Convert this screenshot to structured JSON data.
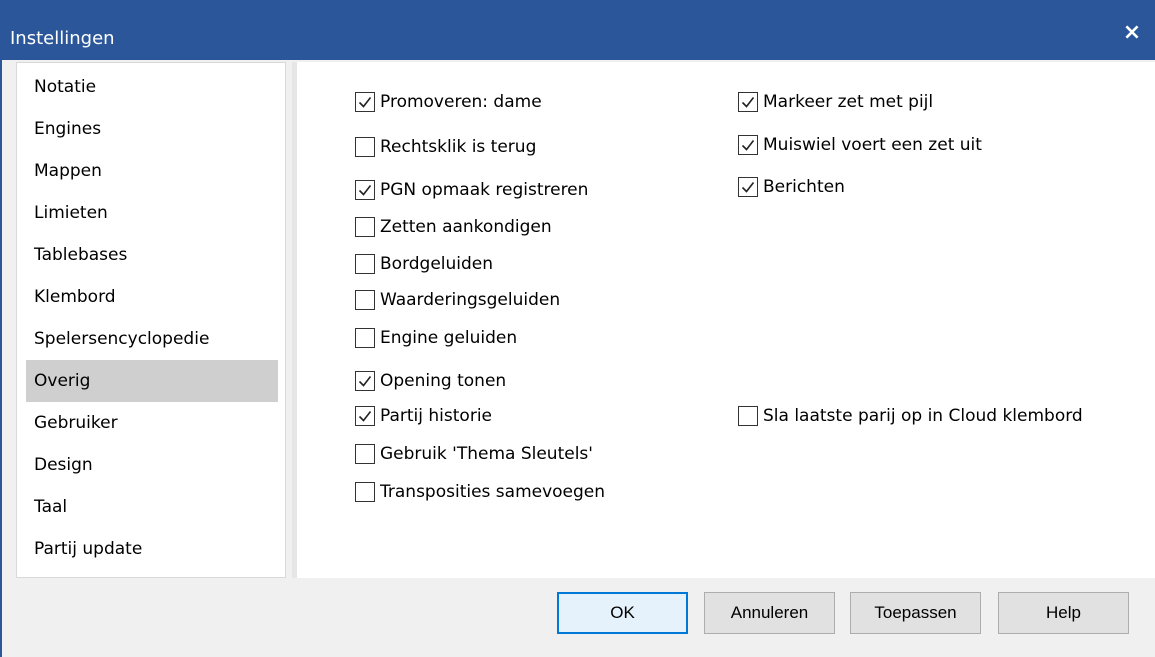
{
  "window": {
    "title": "Instellingen",
    "close_glyph": "×"
  },
  "sidebar": {
    "selected_index": 7,
    "items": [
      {
        "label": "Notatie"
      },
      {
        "label": "Engines"
      },
      {
        "label": "Mappen"
      },
      {
        "label": "Limieten"
      },
      {
        "label": "Tablebases"
      },
      {
        "label": "Klembord"
      },
      {
        "label": "Spelersencyclopedie"
      },
      {
        "label": "Overig"
      },
      {
        "label": "Gebruiker"
      },
      {
        "label": "Design"
      },
      {
        "label": "Taal"
      },
      {
        "label": "Partij update"
      }
    ]
  },
  "options": [
    {
      "label": "Promoveren: dame",
      "checked": true
    },
    {
      "label": "Rechtsklik is terug",
      "checked": false
    },
    {
      "label": "PGN opmaak registreren",
      "checked": true
    },
    {
      "label": "Zetten aankondigen",
      "checked": false
    },
    {
      "label": "Bordgeluiden",
      "checked": false
    },
    {
      "label": "Waarderingsgeluiden",
      "checked": false
    },
    {
      "label": "Engine geluiden",
      "checked": false
    },
    {
      "label": "Opening tonen",
      "checked": true
    },
    {
      "label": "Partij historie",
      "checked": true
    },
    {
      "label": "Gebruik 'Thema Sleutels'",
      "checked": false
    },
    {
      "label": "Transposities samevoegen",
      "checked": false
    },
    {
      "label": "Markeer zet met pijl",
      "checked": true
    },
    {
      "label": "Muiswiel voert een zet uit",
      "checked": true
    },
    {
      "label": "Berichten",
      "checked": true
    },
    {
      "label": "Sla laatste parij op in Cloud klembord",
      "checked": false
    }
  ],
  "buttons": {
    "ok": "OK",
    "cancel": "Annuleren",
    "apply": "Toepassen",
    "help": "Help"
  },
  "icons": {
    "close": "close-icon",
    "check": "checkmark-icon"
  },
  "colors": {
    "titlebar": "#2b579a",
    "selected": "#cfcfcf",
    "default_button_border": "#0078d7"
  }
}
